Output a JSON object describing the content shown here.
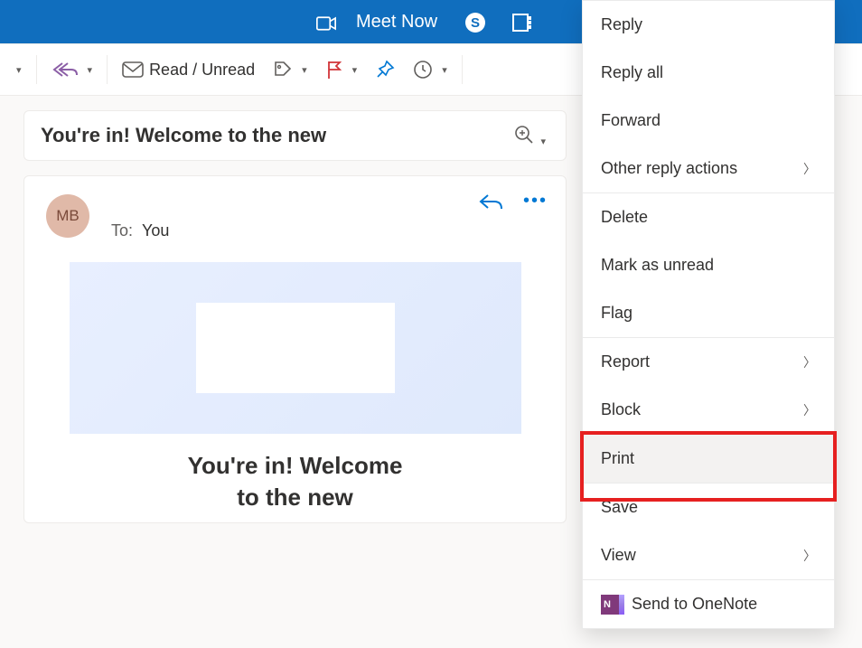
{
  "titlebar": {
    "meet_now": "Meet Now"
  },
  "toolbar": {
    "read_unread": "Read / Unread"
  },
  "subject": "You're in! Welcome to the new",
  "message": {
    "avatar_initials": "MB",
    "to_label": "To:",
    "to_value": "You",
    "banner_title_line1": "You're in! Welcome",
    "banner_title_line2": "to the new"
  },
  "context_menu": {
    "reply": "Reply",
    "reply_all": "Reply all",
    "forward": "Forward",
    "other_reply": "Other reply actions",
    "delete": "Delete",
    "mark_unread": "Mark as unread",
    "flag": "Flag",
    "report": "Report",
    "block": "Block",
    "print": "Print",
    "save": "Save",
    "view": "View",
    "send_onenote": "Send to OneNote"
  }
}
